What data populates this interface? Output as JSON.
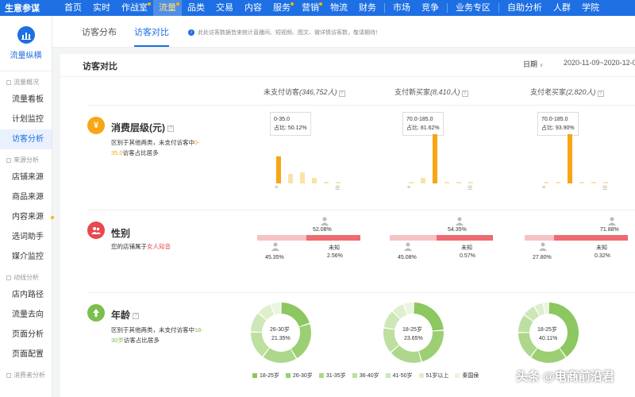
{
  "brand": "生意参谋",
  "nav": [
    {
      "label": "首页"
    },
    {
      "label": "实时"
    },
    {
      "label": "作战室",
      "dot": true
    },
    {
      "label": "流量",
      "active": true,
      "dot": true
    },
    {
      "label": "品类"
    },
    {
      "label": "交易"
    },
    {
      "label": "内容"
    },
    {
      "label": "服务",
      "dot": true
    },
    {
      "label": "营销",
      "dot": true
    },
    {
      "label": "物流"
    },
    {
      "label": "财务"
    },
    {
      "sep": true
    },
    {
      "label": "市场"
    },
    {
      "label": "竞争"
    },
    {
      "sep": true
    },
    {
      "label": "业务专区"
    },
    {
      "sep": true
    },
    {
      "label": "自助分析"
    },
    {
      "label": "人群"
    },
    {
      "label": "学院"
    }
  ],
  "sidebar": {
    "logo_text": "流量纵横",
    "groups": [
      {
        "title": "流量概况",
        "items": [
          {
            "label": "流量看板"
          },
          {
            "label": "计划监控"
          },
          {
            "label": "访客分析",
            "active": true
          }
        ]
      },
      {
        "title": "来源分析",
        "items": [
          {
            "label": "店铺来源"
          },
          {
            "label": "商品来源"
          },
          {
            "label": "内容来源",
            "dot": true
          },
          {
            "label": "选词助手"
          },
          {
            "label": "媒介监控"
          }
        ]
      },
      {
        "title": "动线分析",
        "items": [
          {
            "label": "店内路径"
          },
          {
            "label": "流量去向"
          },
          {
            "label": "页面分析"
          },
          {
            "label": "页面配置"
          }
        ]
      },
      {
        "title": "消费者分析",
        "items": []
      }
    ]
  },
  "tabs": [
    {
      "label": "访客分布"
    },
    {
      "label": "访客对比",
      "active": true
    }
  ],
  "notice": "此处访客数据皆来统计直播间、短视频、图文、微详情访客数，敬请期待！",
  "panel": {
    "title": "访客对比",
    "date_label": "日期",
    "date_range": "2020-11-09~2020-12-08",
    "columns": [
      {
        "label": "未支付访客",
        "count": "(346,752人)"
      },
      {
        "label": "支付新买家",
        "count": "(8,410人)"
      },
      {
        "label": "支付老买家",
        "count": "(2,820人)"
      }
    ]
  },
  "consumption": {
    "icon": "¥",
    "title": "消费层级(元)",
    "desc_pre": "区别于其他两类，未支付访客中",
    "desc_hl": "0-35.0",
    "desc_post": "访客占比居多",
    "color": "#f7a614",
    "columns": [
      {
        "range": "0-35.0",
        "ratio_label": "占比: 50.12%",
        "bars": [
          0.55,
          0.2,
          0.22,
          0.12,
          0.04,
          0.03
        ],
        "highlight": 0
      },
      {
        "range": "70.0-185.0",
        "ratio_label": "占比: 81.62%",
        "bars": [
          0.02,
          0.12,
          1.0,
          0.03,
          0.02,
          0.01
        ],
        "highlight": 2
      },
      {
        "range": "70.0-185.0",
        "ratio_label": "占比: 93.90%",
        "bars": [
          0.01,
          0.02,
          1.0,
          0.02,
          0.01,
          0.01
        ],
        "highlight": 2
      }
    ]
  },
  "gender": {
    "title": "性别",
    "desc_pre": "您的店铺属于",
    "desc_hl": "女人知音",
    "color": "#e8484f",
    "columns": [
      {
        "female": "52.08%",
        "male": "45.35%",
        "unknown_label": "未知",
        "unknown": "2.56%",
        "female_frac": 0.5208
      },
      {
        "female": "54.35%",
        "male": "45.08%",
        "unknown_label": "未知",
        "unknown": "0.57%",
        "female_frac": 0.5435
      },
      {
        "female": "71.88%",
        "male": "27.80%",
        "unknown_label": "未知",
        "unknown": "0.32%",
        "female_frac": 0.7188
      }
    ]
  },
  "age": {
    "title": "年龄",
    "desc_pre": "区别于其他两类，未支付访客中",
    "desc_hl": "18-30岁",
    "desc_post": "访客占比居多",
    "color": "#7bbf4f",
    "columns": [
      {
        "label": "26-30岁",
        "value": "21.35%",
        "slices": [
          0.2,
          0.2135,
          0.19,
          0.15,
          0.11,
          0.08,
          0.0565
        ]
      },
      {
        "label": "18-25岁",
        "value": "23.65%",
        "slices": [
          0.2365,
          0.22,
          0.18,
          0.14,
          0.1,
          0.07,
          0.0535
        ]
      },
      {
        "label": "18-25岁",
        "value": "40.11%",
        "slices": [
          0.4011,
          0.2,
          0.15,
          0.1,
          0.07,
          0.05,
          0.0289
        ]
      }
    ],
    "legend": [
      {
        "label": "18-25岁",
        "color": "#8cc760"
      },
      {
        "label": "26-30岁",
        "color": "#9ccf74"
      },
      {
        "label": "31-35岁",
        "color": "#add78a"
      },
      {
        "label": "36-40岁",
        "color": "#bddf9f"
      },
      {
        "label": "41-50岁",
        "color": "#cde7b6"
      },
      {
        "label": "51岁以上",
        "color": "#ddefcc"
      },
      {
        "label": "秦国侯",
        "color": "#eaf5e0"
      }
    ]
  },
  "watermark": "头条 @电商前沿君"
}
